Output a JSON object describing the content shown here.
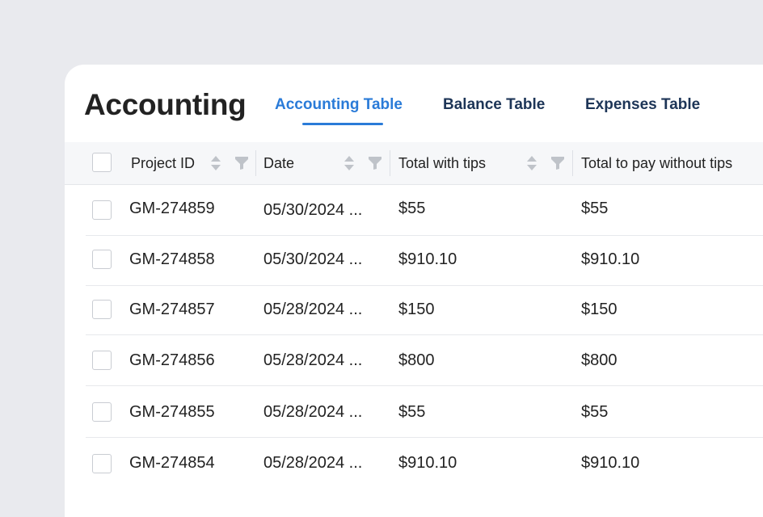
{
  "page": {
    "title": "Accounting"
  },
  "tabs": [
    {
      "label": "Accounting Table",
      "active": true
    },
    {
      "label": "Balance Table",
      "active": false
    },
    {
      "label": "Expenses Table",
      "active": false
    }
  ],
  "table": {
    "columns": [
      {
        "label": "Project ID"
      },
      {
        "label": "Date"
      },
      {
        "label": "Total with tips"
      },
      {
        "label": "Total to pay without tips"
      }
    ],
    "rows": [
      {
        "project_id": "GM-274859",
        "date": "05/30/2024 ...",
        "total_with_tips": "$55",
        "total_without_tips": "$55"
      },
      {
        "project_id": "GM-274858",
        "date": "05/30/2024 ...",
        "total_with_tips": "$910.10",
        "total_without_tips": "$910.10"
      },
      {
        "project_id": "GM-274857",
        "date": "05/28/2024 ...",
        "total_with_tips": "$150",
        "total_without_tips": "$150"
      },
      {
        "project_id": "GM-274856",
        "date": "05/28/2024 ...",
        "total_with_tips": "$800",
        "total_without_tips": "$800"
      },
      {
        "project_id": "GM-274855",
        "date": "05/28/2024 ...",
        "total_with_tips": "$55",
        "total_without_tips": "$55"
      },
      {
        "project_id": "GM-274854",
        "date": "05/28/2024 ...",
        "total_with_tips": "$910.10",
        "total_without_tips": "$910.10"
      }
    ]
  },
  "icons": {
    "sort": "sort-icon",
    "filter": "filter-icon"
  },
  "colors": {
    "accent": "#2a7bd8",
    "tab_text": "#1d3557",
    "header_bg": "#f6f7f9",
    "page_bg": "#e9eaee"
  }
}
